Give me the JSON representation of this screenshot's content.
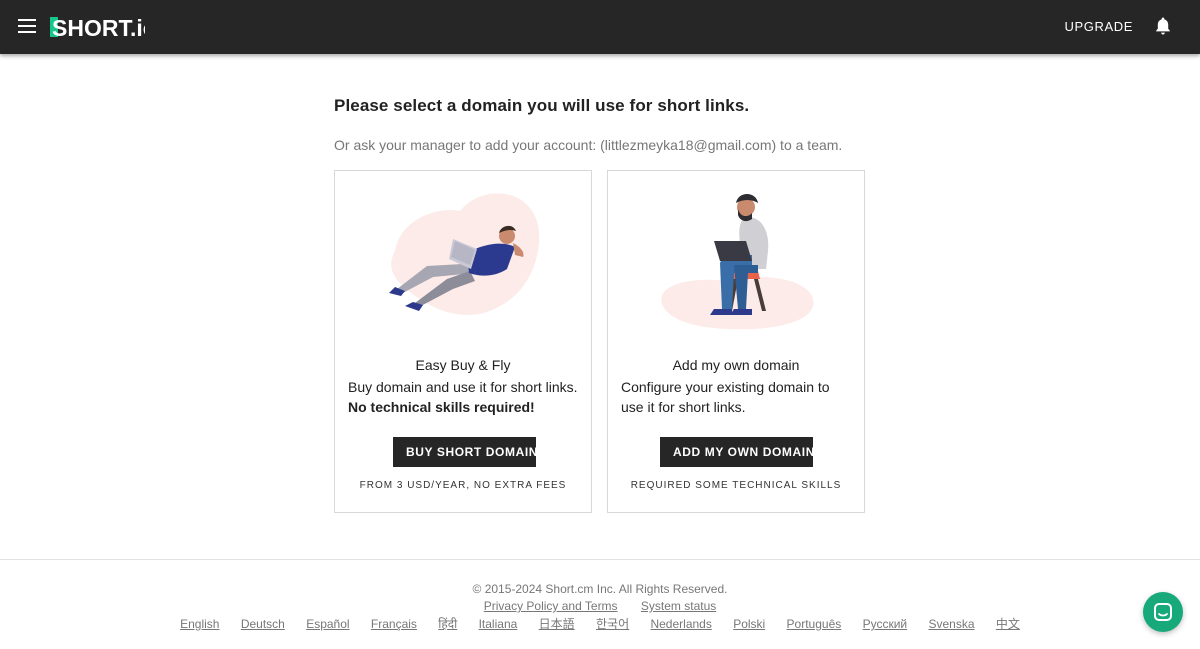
{
  "header": {
    "logo_text": "SHORT.io",
    "upgrade_label": "UPGRADE",
    "icons": [
      "menu-icon",
      "bell-icon"
    ]
  },
  "main": {
    "title": "Please select a domain you will use for short links.",
    "subtitle": "Or ask your manager to add your account: (littlezmeyka18@gmail.com) to a team."
  },
  "cards": [
    {
      "title": "Easy Buy & Fly",
      "desc": "Buy domain and use it for short links.",
      "desc_bold": "No technical skills required!",
      "button": "BUY SHORT DOMAIN",
      "note": "FROM 3 USD/YEAR, NO EXTRA FEES"
    },
    {
      "title": "Add my own domain",
      "desc": "Configure your existing domain to use it for short links.",
      "button": "ADD MY OWN DOMAIN",
      "note": "REQUIRED SOME TECHNICAL SKILLS"
    }
  ],
  "footer": {
    "copyright": "© 2015-2024  Short.cm Inc. All Rights Reserved.",
    "links": [
      "Privacy Policy and Terms",
      "System status"
    ],
    "languages": [
      "English",
      "Deutsch",
      "Español",
      "Français",
      "हिंदी",
      "Italiana",
      "日本語",
      "한국어",
      "Nederlands",
      "Polski",
      "Português",
      "Русский",
      "Svenska",
      "中文"
    ]
  },
  "colors": {
    "topbar": "#262626",
    "accent": "#17a979",
    "button": "#262626"
  }
}
